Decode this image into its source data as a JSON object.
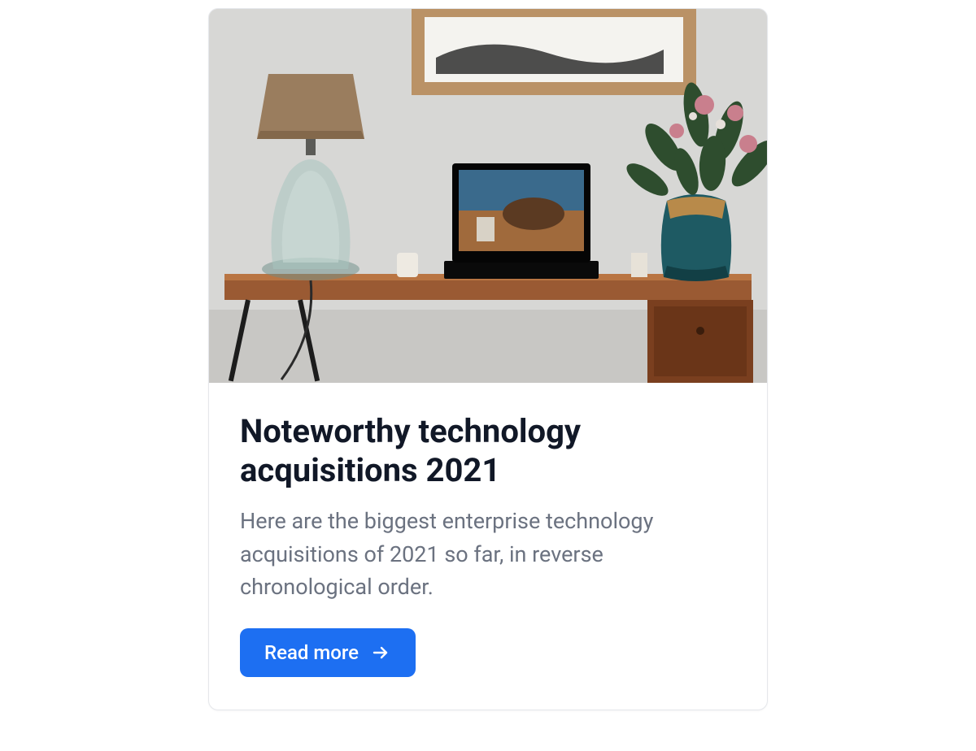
{
  "card": {
    "image_alt": "Wooden desk with a lamp, laptop, and flower vase against a wall with a framed print",
    "title": "Noteworthy technology acquisitions 2021",
    "description": "Here are the biggest enterprise technology acquisitions of 2021 so far, in reverse chronological order.",
    "button_label": "Read more"
  }
}
